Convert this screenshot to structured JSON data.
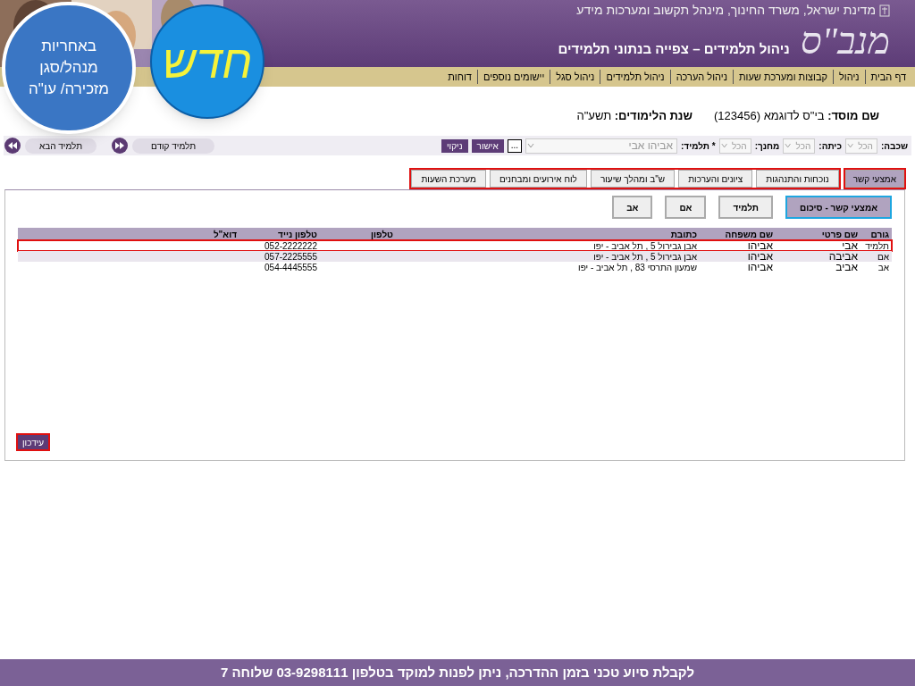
{
  "header": {
    "ministry": "מדינת ישראל, משרד החינוך, מינהל תקשוב ומערכות מידע",
    "logo": "מנב\"ס",
    "title": "ניהול תלמידים – צפייה בנתוני תלמידים"
  },
  "callouts": [
    {
      "kind": "new",
      "text": "חדש"
    },
    {
      "kind": "note",
      "text": "באחריות מנהל/סגן מזכירה/ עו\"ה"
    }
  ],
  "nav": [
    "דף הבית",
    "ניהול",
    "קבוצות ומערכת שעות",
    "ניהול הערכה",
    "ניהול תלמידים",
    "ניהול סגל",
    "יישומים נוספים",
    "דוחות"
  ],
  "institution": {
    "label": "שם מוסד:",
    "value": "בי\"ס לדוגמא (123456)",
    "year_label": "שנת הלימודים:",
    "year": "תשע\"ה"
  },
  "filters": [
    {
      "label": "שכבה:",
      "value": "הכל",
      "kind": "small"
    },
    {
      "label": "כיתה:",
      "value": "הכל",
      "kind": "small"
    },
    {
      "label": "מחנך:",
      "value": "הכל",
      "kind": "small"
    },
    {
      "label": "* תלמיד:",
      "value": "אביהו אבי",
      "kind": "wide"
    }
  ],
  "filter_buttons": {
    "more": "...",
    "ok": "אישור",
    "clear": "ניקוי"
  },
  "student_nav": {
    "prev": "תלמיד קודם",
    "next": "תלמיד הבא"
  },
  "tabs": [
    {
      "label": "אמצעי קשר",
      "selected": true
    },
    {
      "label": "נוכחות והתנהגות",
      "selected": false
    },
    {
      "label": "ציונים והערכות",
      "selected": false
    },
    {
      "label": "ש\"ב ומהלך שיעור",
      "selected": false
    },
    {
      "label": "לוח אירועים ומבחנים",
      "selected": false
    },
    {
      "label": "מערכת השעות",
      "selected": false
    }
  ],
  "subtabs": [
    {
      "label": "אמצעי קשר - סיכום",
      "selected": true
    },
    {
      "label": "תלמיד",
      "selected": false
    },
    {
      "label": "אם",
      "selected": false
    },
    {
      "label": "אב",
      "selected": false
    }
  ],
  "table": {
    "columns": [
      "גורם",
      "שם פרטי",
      "שם משפחה",
      "כתובת",
      "טלפון",
      "טלפון נייד",
      "דוא\"ל"
    ],
    "rows": [
      {
        "cells": [
          "תלמיד",
          "אבי",
          "אביהו",
          "אבן גבירול 5 , תל אביב - יפו",
          "",
          "052-2222222",
          ""
        ],
        "highlighted": true
      },
      {
        "cells": [
          "אם",
          "אביבה",
          "אביהו",
          "אבן גבירול 5 , תל אביב - יפו",
          "",
          "057-2225555",
          ""
        ],
        "highlighted": false
      },
      {
        "cells": [
          "אב",
          "אביב",
          "אביהו",
          "שמעון התרסי 83 , תל אביב - יפו",
          "",
          "054-4445555",
          ""
        ],
        "highlighted": false
      }
    ]
  },
  "update_button": {
    "label": "עידכון",
    "highlighted": true
  },
  "footer": "לקבלת סיוע טכני בזמן ההדרכה, ניתן לפנות למוקד בטלפון 03-9298111 שלוחה 7"
}
